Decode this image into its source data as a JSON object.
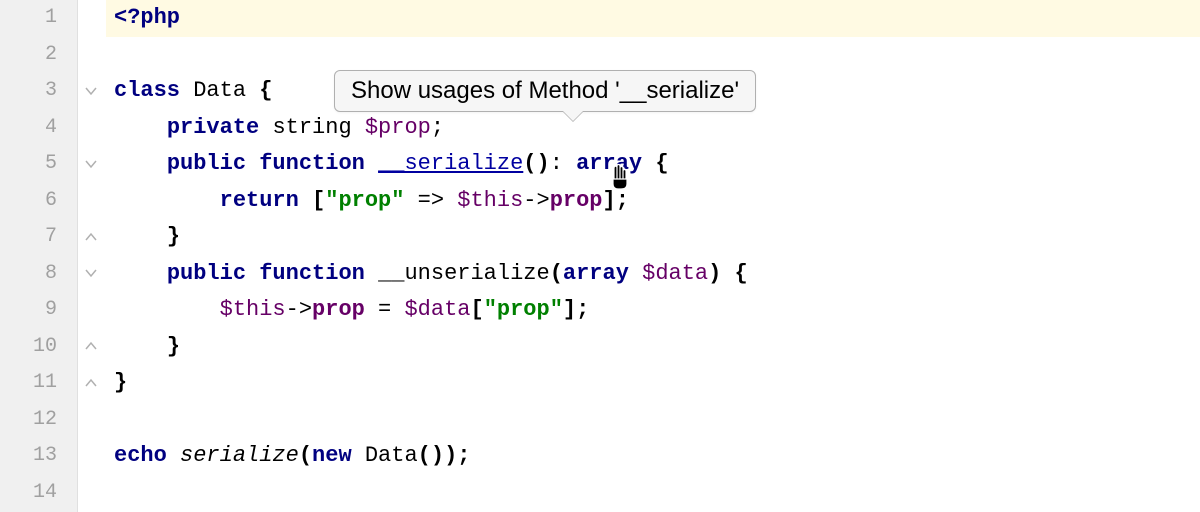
{
  "tooltip": {
    "text": "Show usages of Method '__serialize'"
  },
  "gutter": {
    "lines": [
      "1",
      "2",
      "3",
      "4",
      "5",
      "6",
      "7",
      "8",
      "9",
      "10",
      "11",
      "12",
      "13",
      "14"
    ]
  },
  "code": {
    "l1": {
      "php_open": "<?php"
    },
    "l3": {
      "kw_class": "class ",
      "name": "Data",
      "brace": " {"
    },
    "l4": {
      "kw_priv": "private ",
      "type": "string ",
      "var": "$prop",
      "semi": ";"
    },
    "l5": {
      "kw_pub": "public ",
      "kw_func": "function ",
      "name": "__serialize",
      "sig": "()",
      "colon": ": ",
      "ret": "array",
      "brace": " {"
    },
    "l6": {
      "kw_return": "return ",
      "lb": "[",
      "str": "\"prop\"",
      "arrow": " => ",
      "this": "$this",
      "acc": "->",
      "prop": "prop",
      "rb": "];"
    },
    "l7": {
      "brace": "}"
    },
    "l8": {
      "kw_pub": "public ",
      "kw_func": "function ",
      "name": "__unserialize",
      "lp": "(",
      "ptype": "array ",
      "pvar": "$data",
      "rp": ")",
      "brace": " {"
    },
    "l9": {
      "this": "$this",
      "acc": "->",
      "prop": "prop",
      "eq": " = ",
      "var": "$data",
      "lb": "[",
      "str": "\"prop\"",
      "rb": "];"
    },
    "l10": {
      "brace": "}"
    },
    "l11": {
      "brace": "}"
    },
    "l13": {
      "kw_echo": "echo ",
      "fn": "serialize",
      "lp": "(",
      "kw_new": "new ",
      "cls": "Data",
      "call": "()",
      "rp": ");"
    }
  },
  "folds": [
    {
      "line": 3,
      "type": "open-top"
    },
    {
      "line": 5,
      "type": "open-top"
    },
    {
      "line": 7,
      "type": "close"
    },
    {
      "line": 8,
      "type": "open-top"
    },
    {
      "line": 10,
      "type": "close"
    },
    {
      "line": 11,
      "type": "close"
    }
  ]
}
